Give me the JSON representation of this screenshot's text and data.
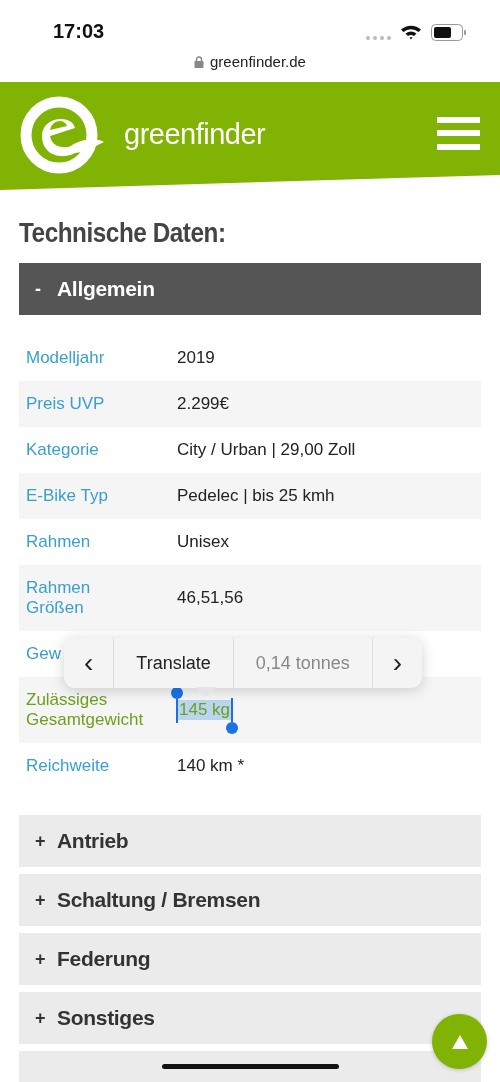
{
  "status_bar": {
    "time": "17:03"
  },
  "address_bar": {
    "url": "greenfinder.de"
  },
  "header": {
    "brand": "greenfinder"
  },
  "page_title": "Technische Daten:",
  "sections": [
    {
      "toggle": "-",
      "title": "Allgemein",
      "expanded": true,
      "rows": [
        {
          "label": "Modelljahr",
          "value": "2019",
          "active": false
        },
        {
          "label": "Preis UVP",
          "value": "2.299€",
          "active": false
        },
        {
          "label": "Kategorie",
          "value": "City / Urban | 29,00 Zoll",
          "active": false
        },
        {
          "label": "E-Bike Typ",
          "value": "Pedelec | bis 25 kmh",
          "active": false
        },
        {
          "label": "Rahmen",
          "value": "Unisex",
          "active": false
        },
        {
          "label": "Rahmen Größen",
          "value": "46,51,56",
          "active": false
        },
        {
          "label": "Gew",
          "active": false
        },
        {
          "label": "Zulässiges Gesamtgewicht",
          "value": "145 kg",
          "active": true,
          "text_selected": true
        },
        {
          "label": "Reichweite",
          "value": "140 km *",
          "active": false
        }
      ]
    },
    {
      "toggle": "+",
      "title": "Antrieb",
      "expanded": false
    },
    {
      "toggle": "+",
      "title": "Schaltung / Bremsen",
      "expanded": false
    },
    {
      "toggle": "+",
      "title": "Federung",
      "expanded": false
    },
    {
      "toggle": "+",
      "title": "Sonstiges",
      "expanded": false
    },
    {
      "expanded": false
    }
  ],
  "selection_menu": {
    "items": [
      {
        "kind": "prev",
        "text": "‹",
        "disabled": false
      },
      {
        "kind": "action",
        "text": "Translate",
        "disabled": false
      },
      {
        "kind": "action",
        "text": "0,14 tonnes",
        "disabled": true
      },
      {
        "kind": "next",
        "text": "›",
        "disabled": false
      }
    ]
  }
}
